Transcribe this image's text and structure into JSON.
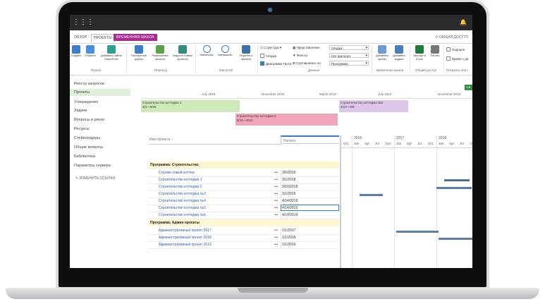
{
  "app": {
    "tabs": [
      {
        "label": "ОБЗОР"
      },
      {
        "label": "ПРОЕКТЫ"
      },
      {
        "label": "ВРЕМЕННАЯ ШКАЛА"
      }
    ],
    "share_label": "ОБЩИЙ ДОСТУП"
  },
  "ribbon": {
    "project_group": {
      "label": "Проект",
      "buttons": [
        "Создать",
        "Открыть",
        "Добавить сайты SharePoint"
      ]
    },
    "navigate_group": {
      "label": "Переход",
      "buttons": [
        "Построение группы",
        "Разрешения проекта",
        "Закрыть новые проекты"
      ]
    },
    "zoom_group": {
      "label": "Масштаб",
      "buttons": [
        "Увеличить",
        "Уменьшить",
        "Перейти к проекту"
      ]
    },
    "data_group": {
      "label": "Данные",
      "structure": "Структура",
      "summary": "Сводки",
      "gantt": "Диаграмма Ганта",
      "view_label": "Представление:",
      "view_value": "Сводка",
      "filter_label": "Фильтр:",
      "filter_value": "Нет фильтра",
      "group_label": "Группировать по:",
      "group_value": "Программа"
    },
    "timeline_group": {
      "label": "Временная шкала",
      "buttons": [
        "Добавить проект",
        "Добавить задачи"
      ]
    },
    "share_group": {
      "label": "Общий доступ",
      "buttons": [
        "Экспорт в Excel",
        "Печать"
      ]
    },
    "show_group": {
      "label": "Показать или с",
      "items": [
        "Подпрое",
        "Время с да"
      ]
    }
  },
  "nav": {
    "items": [
      "Реестр запросов",
      "Проекты",
      "Утверждения",
      "Задачи",
      "Вопросы и риски",
      "Ресурсы",
      "Стейкхолдеры",
      "Общие вопросы",
      "Библиотека",
      "Параметры сервера"
    ],
    "edit_links": "ИЗМЕНИТЬ ССЫЛКИ"
  },
  "timeline": {
    "axis": [
      "July 2018",
      "November 2018",
      "March 2019",
      "July 2019",
      "November 2019"
    ],
    "bars": [
      {
        "title": "Строительство коттеджа 1",
        "dates": "3/1—9/25"
      },
      {
        "title": "Строительство коттеджа 2",
        "dates": "9/10—4/10"
      },
      {
        "title": "Строительство коттеджа №3",
        "dates": "4/14—9/8"
      }
    ],
    "button": "Св"
  },
  "grid": {
    "col_name": "Имя проекта ↑",
    "col_start": "Начало",
    "groups": [
      {
        "title": "Программа: Строительство",
        "rows": [
          {
            "name": "Строим новый коттеж",
            "date": "3/6/2019"
          },
          {
            "name": "Строительство коттеджа 1",
            "date": "3/1/2018"
          },
          {
            "name": "Строительство коттеджа 2",
            "date": "9/10/2018"
          },
          {
            "name": "Строительство коттеджа №3",
            "date": "3/1/2016"
          },
          {
            "name": "Строительство коттеджа №4",
            "date": "4/14/2019"
          },
          {
            "name": "Строительство коттеджа №5",
            "date": "4/14/2019"
          },
          {
            "name": "Строительство коттеджа №6",
            "date": "4/14/2019"
          }
        ]
      },
      {
        "title": "Программа: Админ проекты",
        "rows": [
          {
            "name": "Административный проект 2017",
            "date": "1/1/2017"
          },
          {
            "name": "Административный проект 2018",
            "date": "1/1/2018"
          },
          {
            "name": "Административный проект 2019",
            "date": "1/1/2019"
          }
        ]
      }
    ]
  },
  "gantt": {
    "years": [
      "2016",
      "2017",
      "2018"
    ],
    "months": [
      "Oct",
      "Jan",
      "Apr",
      "Jul",
      "Oct",
      "Jan",
      "Apr",
      "Jul",
      "Oct",
      "Jan",
      "Apr",
      "Jul",
      "O"
    ]
  },
  "colors": {
    "accent": "#a82c8f",
    "selected_nav": "#dff0d8",
    "group_row": "#fff7d1",
    "link": "#2b63b7",
    "bar_green": "#cde9b7",
    "bar_pink": "#f0a6b8",
    "bar_purple": "#ddc6ea"
  }
}
